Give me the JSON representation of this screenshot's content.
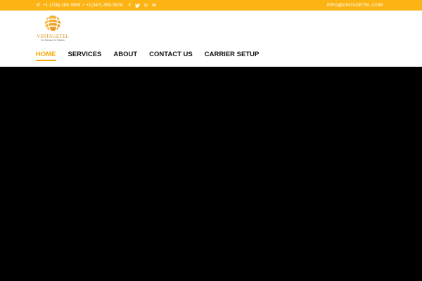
{
  "topbar": {
    "phone_icon": "phone-icon",
    "phone_1": "+1 (718) 285 3995",
    "separator": "/",
    "phone_2": "+1(347)-395-3578",
    "social": [
      {
        "icon": "facebook-icon",
        "glyph": "f"
      },
      {
        "icon": "twitter-icon",
        "glyph": "t"
      },
      {
        "icon": "instagram-icon",
        "glyph": "◎"
      },
      {
        "icon": "linkedin-icon",
        "glyph": "in"
      }
    ],
    "email": "INFO@VINTAGETEL.COM",
    "background": "#fcb415"
  },
  "logo": {
    "name": "VINTAGETEL",
    "tagline": "Your Business, Our Solutions"
  },
  "nav": {
    "items": [
      {
        "label": "HOME",
        "active": true
      },
      {
        "label": "SERVICES",
        "active": false
      },
      {
        "label": "ABOUT",
        "active": false
      },
      {
        "label": "CONTACT US",
        "active": false
      },
      {
        "label": "CARRIER SETUP",
        "active": false
      }
    ],
    "accent": "#f5a80c"
  },
  "hero": {
    "background": "#000000"
  }
}
